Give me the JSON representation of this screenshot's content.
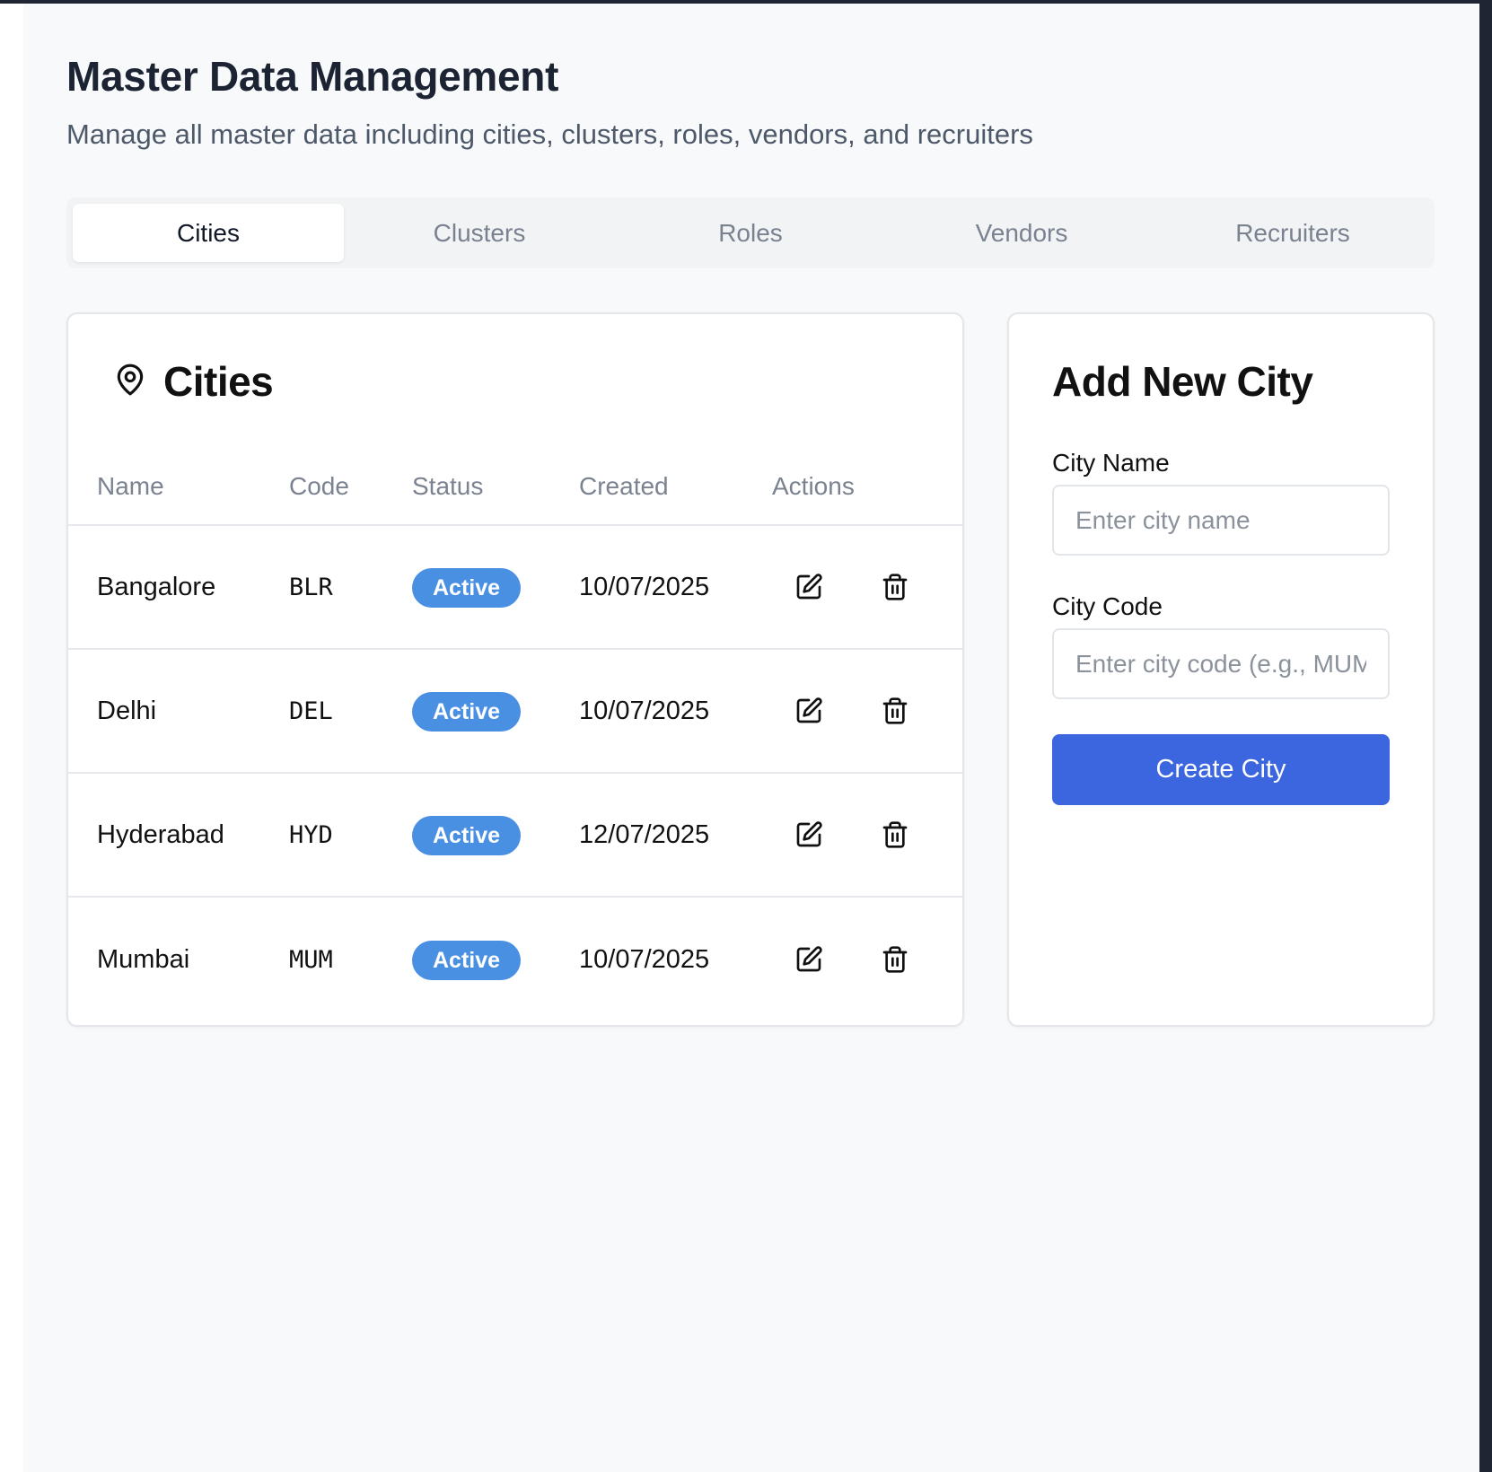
{
  "page": {
    "title": "Master Data Management",
    "subtitle": "Manage all master data including cities, clusters, roles, vendors, and recruiters"
  },
  "tabs": [
    {
      "label": "Cities",
      "active": true
    },
    {
      "label": "Clusters",
      "active": false
    },
    {
      "label": "Roles",
      "active": false
    },
    {
      "label": "Vendors",
      "active": false
    },
    {
      "label": "Recruiters",
      "active": false
    }
  ],
  "cities_card": {
    "title": "Cities",
    "icon": "map-pin-icon",
    "columns": [
      "Name",
      "Code",
      "Status",
      "Created",
      "Actions"
    ],
    "rows": [
      {
        "name": "Bangalore",
        "code": "BLR",
        "status": "Active",
        "created": "10/07/2025"
      },
      {
        "name": "Delhi",
        "code": "DEL",
        "status": "Active",
        "created": "10/07/2025"
      },
      {
        "name": "Hyderabad",
        "code": "HYD",
        "status": "Active",
        "created": "12/07/2025"
      },
      {
        "name": "Mumbai",
        "code": "MUM",
        "status": "Active",
        "created": "10/07/2025"
      }
    ],
    "action_icons": [
      "edit-icon",
      "trash-icon"
    ]
  },
  "form": {
    "title": "Add New City",
    "city_name_label": "City Name",
    "city_name_placeholder": "Enter city name",
    "city_name_value": "",
    "city_code_label": "City Code",
    "city_code_placeholder": "Enter city code (e.g., MUM)",
    "city_code_value": "",
    "submit_label": "Create City"
  },
  "colors": {
    "accent": "#3b66e0",
    "badge": "#4a90e2",
    "background": "#f8f9fb"
  }
}
